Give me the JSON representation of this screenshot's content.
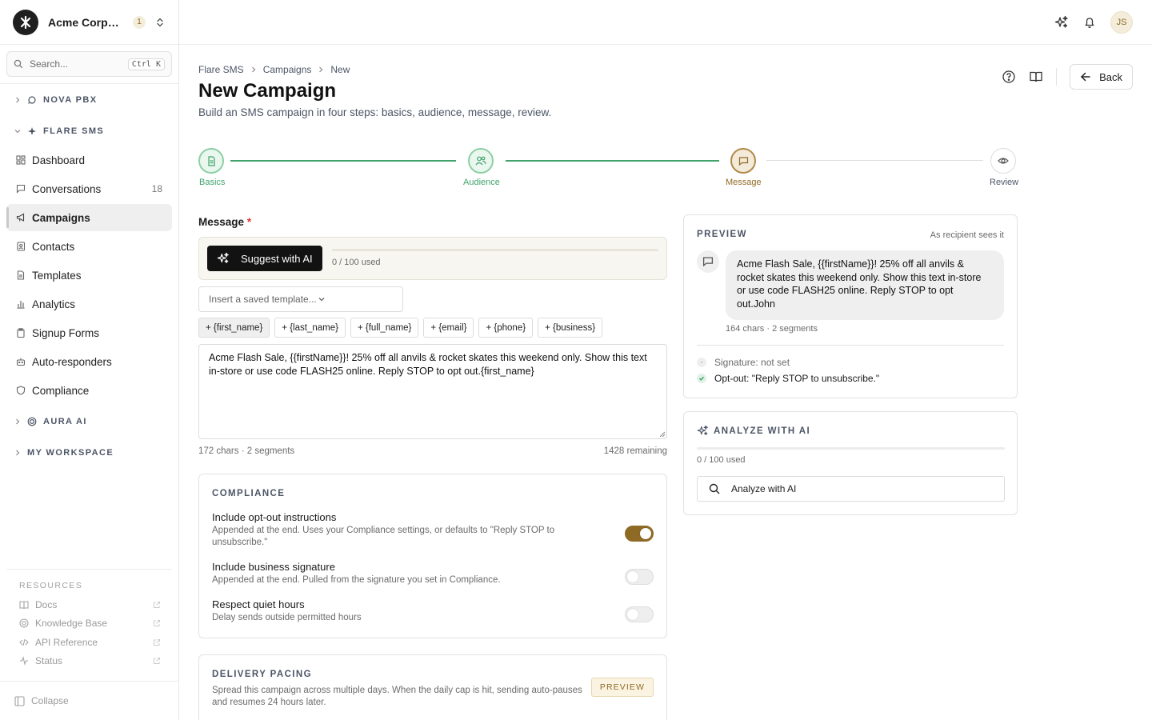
{
  "org": {
    "name": "Acme Corporation",
    "badge": "1"
  },
  "sidebar": {
    "search": {
      "placeholder": "Search...",
      "shortcut": "Ctrl K"
    },
    "groups": [
      {
        "label": "NOVA PBX"
      },
      {
        "label": "FLARE SMS"
      },
      {
        "label": "AURA AI"
      },
      {
        "label": "MY WORKSPACE"
      }
    ],
    "items": [
      {
        "label": "Dashboard"
      },
      {
        "label": "Conversations",
        "count": "18"
      },
      {
        "label": "Campaigns"
      },
      {
        "label": "Contacts"
      },
      {
        "label": "Templates"
      },
      {
        "label": "Analytics"
      },
      {
        "label": "Signup Forms"
      },
      {
        "label": "Auto-responders"
      },
      {
        "label": "Compliance"
      }
    ],
    "resources": {
      "title": "RESOURCES",
      "items": [
        {
          "label": "Docs"
        },
        {
          "label": "Knowledge Base"
        },
        {
          "label": "API Reference"
        },
        {
          "label": "Status"
        }
      ]
    },
    "collapse_label": "Collapse"
  },
  "topbar": {
    "avatar_initials": "JS"
  },
  "breadcrumb": [
    "Flare SMS",
    "Campaigns",
    "New"
  ],
  "page": {
    "title": "New Campaign",
    "subtitle": "Build an SMS campaign in four steps: basics, audience, message, review.",
    "back_label": "Back"
  },
  "steps": [
    {
      "label": "Basics",
      "state": "done"
    },
    {
      "label": "Audience",
      "state": "done"
    },
    {
      "label": "Message",
      "state": "current"
    },
    {
      "label": "Review",
      "state": "pending"
    }
  ],
  "message": {
    "label": "Message",
    "required_mark": "*",
    "suggest_label": "Suggest with AI",
    "ai_usage": "0 / 100 used",
    "template_placeholder": "Insert a saved template...",
    "tokens": [
      "+ {first_name}",
      "+ {last_name}",
      "+ {full_name}",
      "+ {email}",
      "+ {phone}",
      "+ {business}"
    ],
    "body": "Acme Flash Sale, {{firstName}}! 25% off all anvils & rocket skates this weekend only. Show this text in-store or use code FLASH25 online. Reply STOP to opt out.{first_name}",
    "stats_left": "172 chars · 2 segments",
    "stats_right": "1428 remaining"
  },
  "compliance": {
    "title": "COMPLIANCE",
    "options": [
      {
        "title": "Include opt-out instructions",
        "desc": "Appended at the end. Uses your Compliance settings, or defaults to \"Reply STOP to unsubscribe.\"",
        "on": true
      },
      {
        "title": "Include business signature",
        "desc": "Appended at the end. Pulled from the signature you set in Compliance.",
        "on": false
      },
      {
        "title": "Respect quiet hours",
        "desc": "Delay sends outside permitted hours",
        "on": false
      }
    ]
  },
  "pacing": {
    "title": "DELIVERY PACING",
    "desc": "Spread this campaign across multiple days. When the daily cap is hit, sending auto-pauses and resumes 24 hours later.",
    "badge": "PREVIEW"
  },
  "preview": {
    "title": "PREVIEW",
    "hint": "As recipient sees it",
    "bubble": "Acme Flash Sale, {{firstName}}! 25% off all anvils & rocket skates this weekend only. Show this text in-store or use code FLASH25 online. Reply STOP to opt out.John",
    "stats": "164 chars · 2 segments",
    "signature": "Signature: not set",
    "optout": "Opt-out: \"Reply STOP to unsubscribe.\""
  },
  "analyze": {
    "title": "ANALYZE WITH AI",
    "usage": "0 / 100 used",
    "button_label": "Analyze with AI"
  },
  "colors": {
    "accent": "#8f6a24",
    "success": "#41a36a",
    "step_current": "#b08a4a"
  }
}
